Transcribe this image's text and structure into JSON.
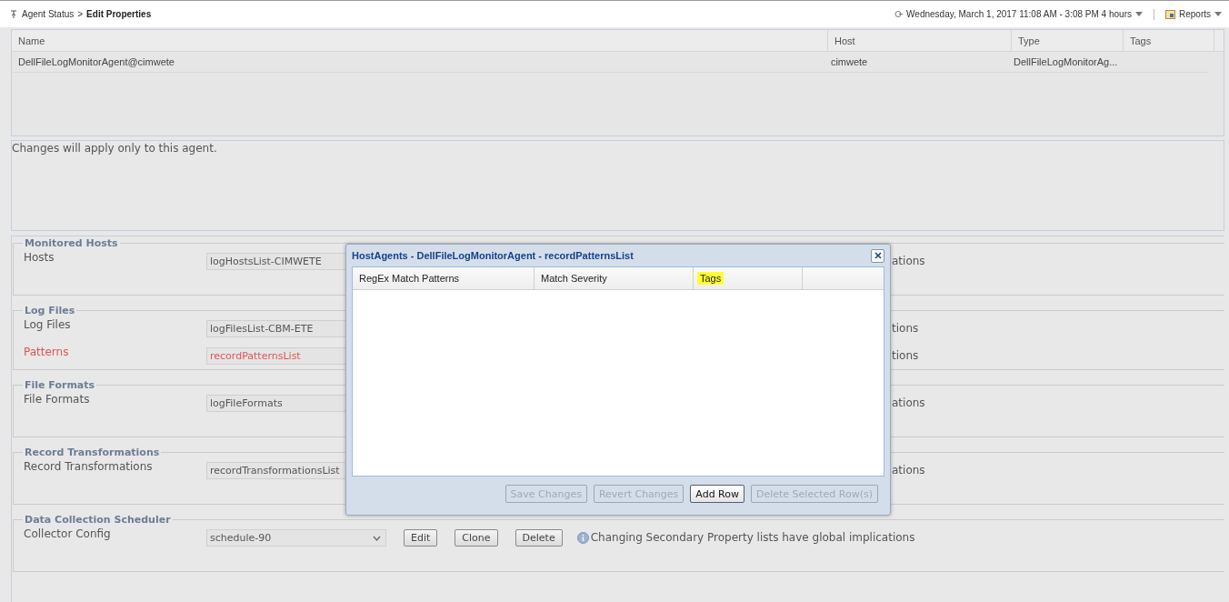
{
  "breadcrumb": {
    "parent": "Agent Status",
    "separator": ">",
    "current": "Edit Properties"
  },
  "time_range": "Wednesday, March 1, 2017 11:08 AM - 3:08 PM 4 hours",
  "reports_label": "Reports",
  "agents_table": {
    "columns": [
      "Name",
      "Host",
      "Type",
      "Tags"
    ],
    "rows": [
      {
        "name": "DellFileLogMonitorAgent@cimwete",
        "host": "cimwete",
        "type": "DellFileLogMonitorAg...",
        "tags": ""
      }
    ]
  },
  "message": "Changes will apply only to this agent.",
  "sections": [
    {
      "legend": "Monitored Hosts",
      "rows": [
        {
          "kind": "covered",
          "label": "Hosts",
          "value": "logHostsList-CIMWETE",
          "error": false,
          "fragment": "ations"
        }
      ]
    },
    {
      "legend": "Log Files",
      "rows": [
        {
          "kind": "covered",
          "label": "Log Files",
          "value": "logFilesList-CBM-ETE",
          "error": false,
          "fragment": "tions"
        },
        {
          "kind": "covered",
          "label": "Patterns",
          "value": "recordPatternsList",
          "error": true,
          "fragment": "tions"
        }
      ]
    },
    {
      "legend": "File Formats",
      "rows": [
        {
          "kind": "covered",
          "label": "File Formats",
          "value": "logFileFormats",
          "error": false,
          "fragment": "ations"
        }
      ]
    },
    {
      "legend": "Record Transformations",
      "rows": [
        {
          "kind": "covered",
          "label": "Record Transformations",
          "value": "recordTransformationsList",
          "error": false,
          "fragment": "ations"
        }
      ]
    },
    {
      "legend": "Data Collection Scheduler",
      "rows": [
        {
          "kind": "full",
          "label": "Collector Config",
          "value": "schedule-90",
          "error": false,
          "buttons": [
            "Edit",
            "Clone",
            "Delete"
          ],
          "note": "Changing Secondary Property lists have global implications"
        }
      ]
    }
  ],
  "dialog": {
    "title": "HostAgents - DellFileLogMonitorAgent - recordPatternsList",
    "columns": [
      {
        "label": "RegEx Match Patterns",
        "highlighted": false
      },
      {
        "label": "Match Severity",
        "highlighted": false
      },
      {
        "label": "Tags",
        "highlighted": true
      }
    ],
    "buttons": [
      {
        "label": "Save Changes",
        "disabled": true
      },
      {
        "label": "Revert Changes",
        "disabled": true
      },
      {
        "label": "Add Row",
        "disabled": false
      },
      {
        "label": "Delete Selected Row(s)",
        "disabled": true
      }
    ]
  }
}
